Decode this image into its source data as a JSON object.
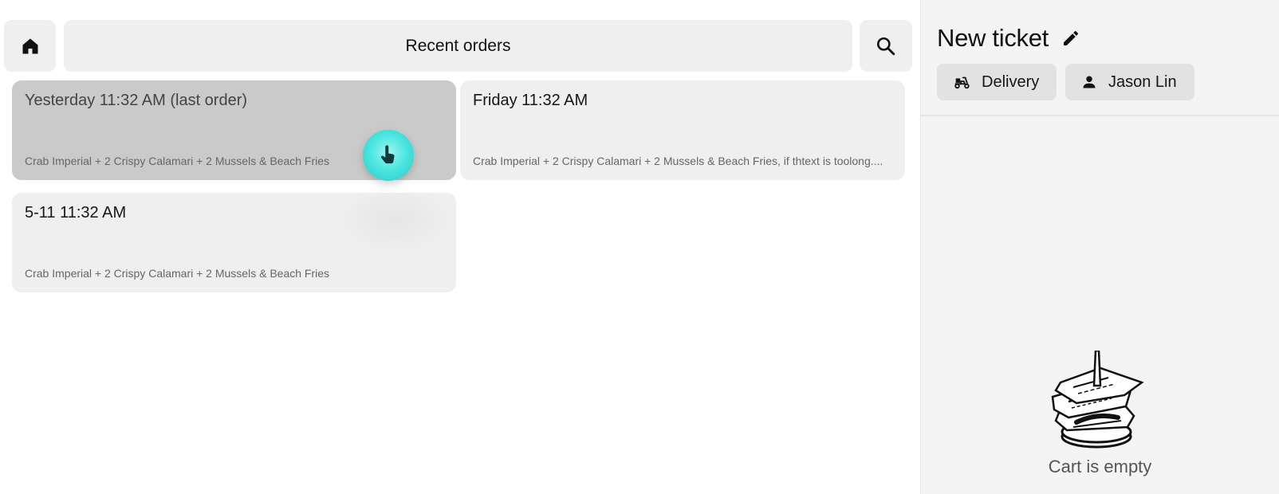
{
  "header": {
    "title": "Recent orders",
    "home_icon": "home-icon",
    "search_icon": "search-icon"
  },
  "orders": [
    {
      "time": "Yesterday 11:32 AM (last order)",
      "items": "Crab Imperial + 2 Crispy Calamari + 2 Mussels & Beach Fries",
      "selected": true
    },
    {
      "time": "Friday 11:32 AM",
      "items": "Crab Imperial + 2 Crispy Calamari + 2 Mussels & Beach Fries, if thtext is toolong....",
      "selected": false
    },
    {
      "time": "5-11 11:32 AM",
      "items": "Crab Imperial + 2 Crispy Calamari + 2 Mussels & Beach Fries",
      "selected": false
    }
  ],
  "ticket": {
    "title": "New ticket",
    "edit_icon": "pencil-icon",
    "order_type": "Delivery",
    "order_type_icon": "scooter-icon",
    "customer": "Jason Lin",
    "customer_icon": "person-icon",
    "empty_message": "Cart is empty",
    "empty_illustration": "receipt-spike-icon"
  },
  "colors": {
    "card_bg": "#efefef",
    "card_selected_bg": "#cacaca",
    "panel_bg": "#f4f4f4",
    "chip_bg": "#e2e2e2",
    "touch_accent": "#4fe6e0"
  }
}
